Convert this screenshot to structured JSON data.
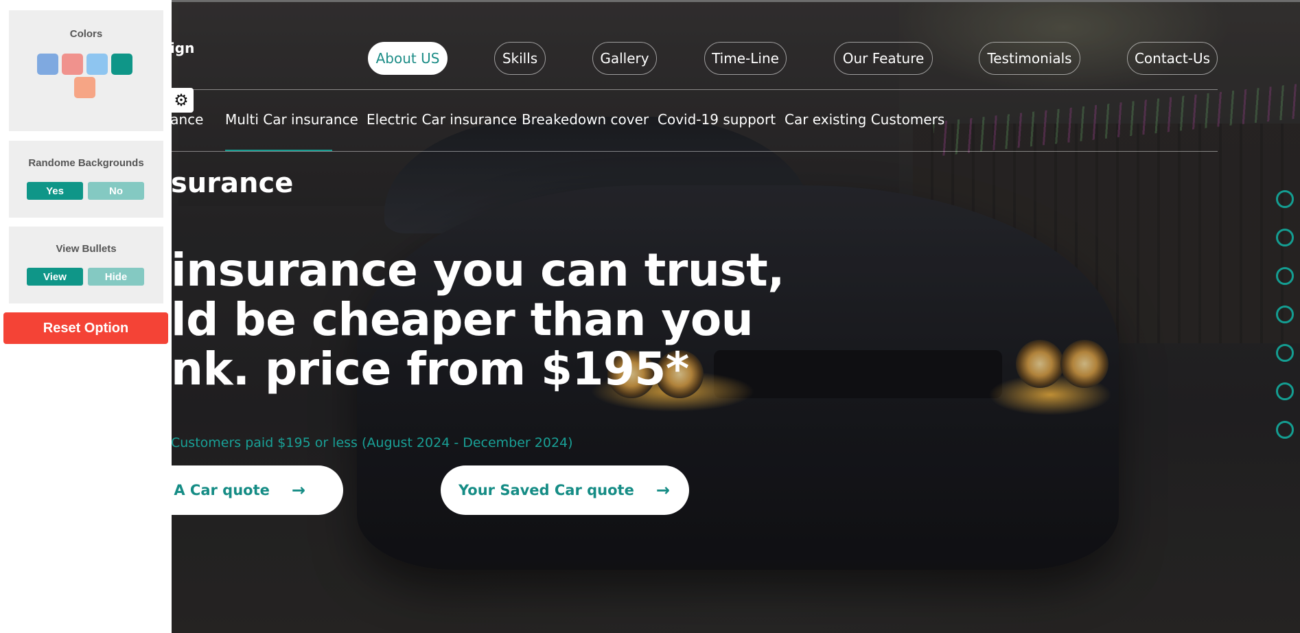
{
  "brand": {
    "logo_text": "sign"
  },
  "nav": {
    "items": [
      {
        "label": "About US",
        "active": true
      },
      {
        "label": "Skills"
      },
      {
        "label": "Gallery"
      },
      {
        "label": "Time-Line"
      },
      {
        "label": "Our Feature"
      },
      {
        "label": "Testimonials"
      },
      {
        "label": "Contact-Us"
      }
    ]
  },
  "subnav": {
    "items": [
      {
        "label": "rance"
      },
      {
        "label": "Multi Car insurance"
      },
      {
        "label": "Electric Car insurance"
      },
      {
        "label": "Breakedown cover"
      },
      {
        "label": "Covid-19 support"
      },
      {
        "label": "Car existing Customers"
      }
    ]
  },
  "hero": {
    "subtitle": "surance",
    "headline_lines": [
      "insurance you can trust,",
      "ld be cheaper than you",
      "nk. price from $195*"
    ],
    "note": "Customers paid $195 or less (August 2024 - December 2024)",
    "cta_primary": "t A Car quote",
    "cta_secondary": "Your Saved Car quote",
    "arrow": "→"
  },
  "bullets": {
    "count": 7,
    "color": "#149e92"
  },
  "settings": {
    "gear_icon": "⚙",
    "colors": {
      "title": "Colors",
      "swatches": [
        "#7fa9e0",
        "#f0928d",
        "#8ec5f0",
        "#0f9688",
        "#f6a585"
      ]
    },
    "backgrounds": {
      "title": "Randome Backgrounds",
      "yes": "Yes",
      "no": "No"
    },
    "bullets": {
      "title": "View Bullets",
      "view": "View",
      "hide": "Hide"
    },
    "reset": "Reset Option"
  },
  "colors": {
    "accent": "#149e92",
    "danger": "#f44336"
  }
}
